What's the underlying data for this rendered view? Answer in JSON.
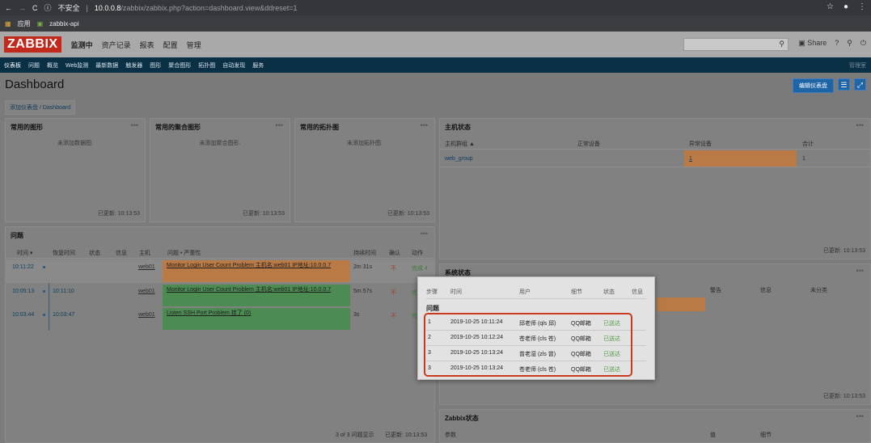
{
  "browser": {
    "insecure_label": "不安全",
    "url_host": "10.0.0.8",
    "url_path": "/zabbix/zabbix.php?action=dashboard.view&ddreset=1",
    "bookmarks": [
      "应用",
      "zabbix-api"
    ]
  },
  "header": {
    "logo": "ZABBIX",
    "menu": [
      "监测中",
      "资产记录",
      "报表",
      "配置",
      "管理"
    ],
    "share": "Share",
    "help": "?",
    "user": "⚲",
    "logout": "⏻"
  },
  "submenu": {
    "items": [
      "仪表板",
      "问题",
      "概览",
      "Web监测",
      "最新数据",
      "触发器",
      "图形",
      "聚合图形",
      "拓扑图",
      "自动发现",
      "服务"
    ],
    "right": "管理室"
  },
  "page": {
    "title": "Dashboard",
    "edit_button": "编辑仪表盘",
    "breadcrumb_parent": "添加仪表盘",
    "breadcrumb_sep": "/",
    "breadcrumb_current": "Dashboard"
  },
  "widgets": {
    "fav_graphs": {
      "title": "常用的图形",
      "empty": "未添加数据图.",
      "updated": "已更新: 10:13:53"
    },
    "fav_screens": {
      "title": "常用的聚合图形",
      "empty": "未添加聚合图形.",
      "updated": "已更新: 10:13:53"
    },
    "fav_maps": {
      "title": "常用的拓扑图",
      "empty": "未添加拓扑图.",
      "updated": "已更新: 10:13:53"
    },
    "host_status": {
      "title": "主机状态",
      "cols": [
        "主机群组 ▲",
        "正常设备",
        "异常设备",
        "合计"
      ],
      "row": {
        "group": "web_group",
        "ok": "",
        "problem": "1",
        "total": "1"
      },
      "updated": "已更新: 10:13:53"
    },
    "problems": {
      "title": "问题",
      "cols": [
        "时间 ▾",
        "恢复时间",
        "状态",
        "信息",
        "主机",
        "问题 • 严重性",
        "持续时间",
        "确认",
        "动作"
      ],
      "rows": [
        {
          "time": "10:11:22",
          "recovery": "",
          "host": "web01",
          "problem": "Monitor Login User Count Problem 主机名:web01 IP地址:10.0.0.7",
          "duration": "2m 31s",
          "ack": "不",
          "action": "完成 4"
        },
        {
          "time": "10:05:13",
          "recovery": "10:11:10",
          "host": "web01",
          "problem": "Monitor Login User Count Problem 主机名:web01 IP地址:10.0.0.7",
          "duration": "5m 57s",
          "ack": "不",
          "action": "完"
        },
        {
          "time": "10:03:44",
          "recovery": "10:03:47",
          "host": "web01",
          "problem": "Listen SSH Port Problem 挂了 (0)",
          "duration": "3s",
          "ack": "不",
          "action": "完"
        }
      ],
      "footer_count": "3 of 3 问题显示",
      "updated": "已更新: 10:13:53"
    },
    "system_status": {
      "title": "系统状态",
      "cols": [
        "警告",
        "信息",
        "未分类"
      ],
      "updated": "已更新: 10:13:53"
    },
    "zabbix_status": {
      "title": "Zabbix状态",
      "cols": [
        "参数",
        "值",
        "细节"
      ]
    }
  },
  "popup": {
    "cols": [
      "步骤",
      "时间",
      "用户",
      "细节",
      "状态",
      "信息"
    ],
    "group": "问题",
    "rows": [
      {
        "step": "1",
        "time": "2019-10-25 10:11:24",
        "user": "邱老师 (qls 邱)",
        "detail": "QQ邮箱",
        "status": "已送达"
      },
      {
        "step": "2",
        "time": "2019-10-25 10:12:24",
        "user": "苍老师 (cls 苍)",
        "detail": "QQ邮箱",
        "status": "已送达"
      },
      {
        "step": "3",
        "time": "2019-10-25 10:13:24",
        "user": "曾老湿 (zls 曾)",
        "detail": "QQ邮箱",
        "status": "已送达"
      },
      {
        "step": "3",
        "time": "2019-10-25 10:13:24",
        "user": "苍老师 (cls 苍)",
        "detail": "QQ邮箱",
        "status": "已送达"
      }
    ]
  },
  "colors": {
    "accent": "#1f65a6",
    "problem": "#e97f36",
    "ok": "#59db8f",
    "logo": "#d40000"
  },
  "misc": {
    "dots": "•••"
  }
}
